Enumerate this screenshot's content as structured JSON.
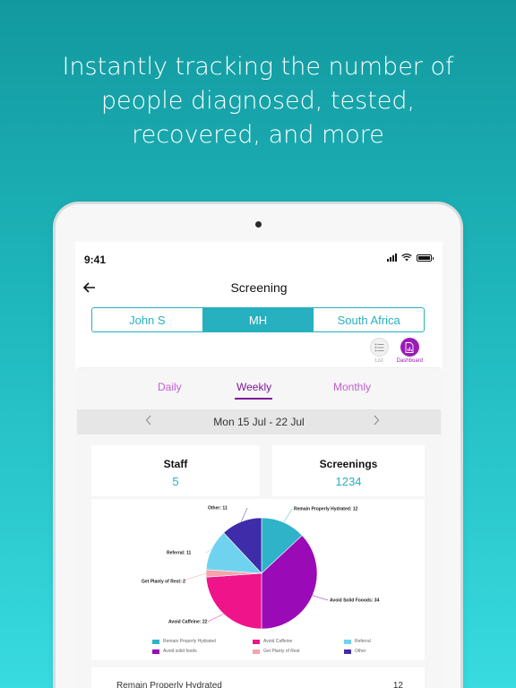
{
  "headline": {
    "line1": "Instantly tracking the number of",
    "line2": "people diagnosed, tested,",
    "line3": "recovered, and more"
  },
  "status_bar": {
    "time": "9:41"
  },
  "nav": {
    "title": "Screening",
    "back_icon": "arrow-left-icon"
  },
  "segments": [
    {
      "label": "John S",
      "active": false
    },
    {
      "label": "MH",
      "active": true
    },
    {
      "label": "South Africa",
      "active": false
    }
  ],
  "view_toggle": {
    "list_label": "List",
    "dashboard_label": "Dashboard"
  },
  "period_tabs": [
    {
      "label": "Daily",
      "active": false
    },
    {
      "label": "Weekly",
      "active": true
    },
    {
      "label": "Monthly",
      "active": false
    }
  ],
  "date_range": {
    "label": "Mon 15 Jul - 22 Jul"
  },
  "stats": {
    "staff": {
      "title": "Staff",
      "value": "5"
    },
    "screenings": {
      "title": "Screenings",
      "value": "1234"
    }
  },
  "colors": {
    "accent_teal": "#27b0bf",
    "accent_purple": "#9b1bb7"
  },
  "chart_data": {
    "type": "pie",
    "slices": [
      {
        "label": "Remain Properly Hydrated: 12",
        "value": 12,
        "color": "#2fb3c9"
      },
      {
        "label": "Avoid Solid Fooods: 34",
        "value": 34,
        "color": "#9a0ab6"
      },
      {
        "label": "Avoid Caffeine: 22",
        "value": 22,
        "color": "#f0148a"
      },
      {
        "label": "Get Planty of Rest: 2",
        "value": 2,
        "color": "#f5a3ad"
      },
      {
        "label": "Referral: 11",
        "value": 11,
        "color": "#6fd3ef"
      },
      {
        "label": "Other: 11",
        "value": 11,
        "color": "#3e2ca8"
      }
    ],
    "legend": [
      {
        "label": "Remain Properly Hydrated",
        "color": "#2fb3c9"
      },
      {
        "label": "Avoid Caffeine",
        "color": "#f0148a"
      },
      {
        "label": "Referral",
        "color": "#6fd3ef"
      },
      {
        "label": "Avoid solid foods",
        "color": "#9a0ab6"
      },
      {
        "label": "Get Planty of Rest",
        "color": "#f5a3ad"
      },
      {
        "label": "Other",
        "color": "#3e2ca8"
      }
    ]
  },
  "summary": {
    "name": "Remain Properly Hydrated",
    "value": "12"
  }
}
